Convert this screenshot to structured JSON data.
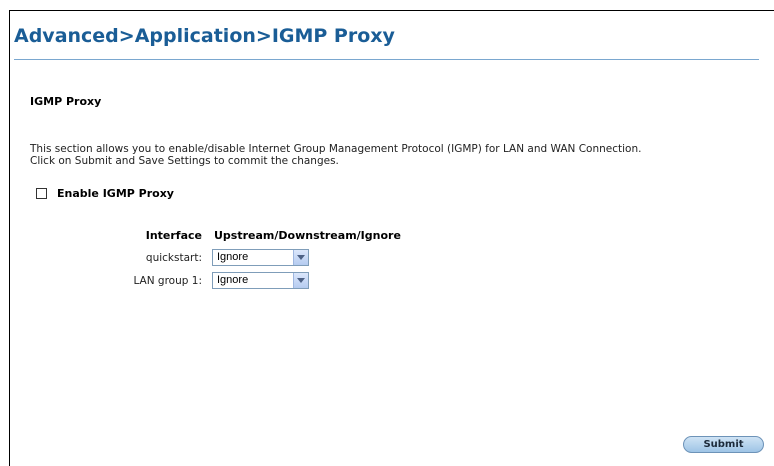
{
  "page_title": "Advanced>Application>IGMP Proxy",
  "section_heading": "IGMP Proxy",
  "description_line1": "This section allows you to enable/disable Internet Group Management Protocol (IGMP) for LAN and WAN Connection.",
  "description_line2": "Click on Submit and Save Settings to commit the changes.",
  "enable_checkbox": {
    "label": "Enable IGMP Proxy",
    "checked": false
  },
  "table": {
    "headers": [
      "Interface",
      "Upstream/Downstream/Ignore"
    ],
    "rows": [
      {
        "interface": "quickstart:",
        "mode": "Ignore"
      },
      {
        "interface": "LAN group 1:",
        "mode": "Ignore"
      }
    ]
  },
  "submit_label": "Submit",
  "colors": {
    "title": "#1a5d96",
    "rule": "#7aa7cf",
    "button": "#9ec4e6"
  }
}
